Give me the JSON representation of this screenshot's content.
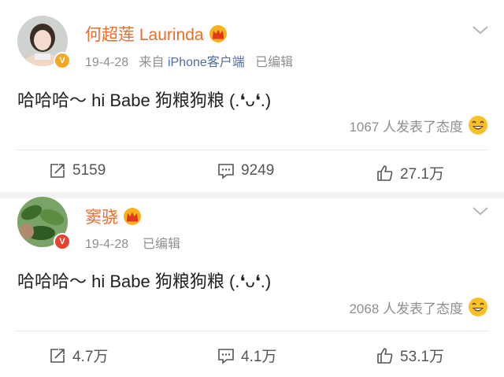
{
  "posts": [
    {
      "author": "何超莲 Laurinda",
      "meta_date": "19-4-28",
      "meta_from": "来自",
      "meta_source": "iPhone客户端",
      "meta_edited": "已编辑",
      "content": "哈哈哈～ hi Babe 狗粮狗粮 (.❛ᴗ❛.)",
      "attitude": "1067 人发表了态度",
      "repost": "5159",
      "comment": "9249",
      "like": "27.1万",
      "verified_color": "#f5a623"
    },
    {
      "author": "窦骁",
      "meta_date": "19-4-28",
      "meta_edited": "已编辑",
      "content": "哈哈哈～ hi Babe 狗粮狗粮 (.❛ᴗ❛.)",
      "attitude": "2068 人发表了态度",
      "repost": "4.7万",
      "comment": "4.1万",
      "like": "53.1万",
      "verified_color": "#e8432e"
    }
  ],
  "icons": {
    "crown": "crown-icon",
    "verified": "verified-badge-icon",
    "chevron": "chevron-down-icon",
    "repost": "repost-icon",
    "comment": "comment-icon",
    "like": "thumbs-up-icon",
    "emoji": "laughing-emoji-icon"
  }
}
